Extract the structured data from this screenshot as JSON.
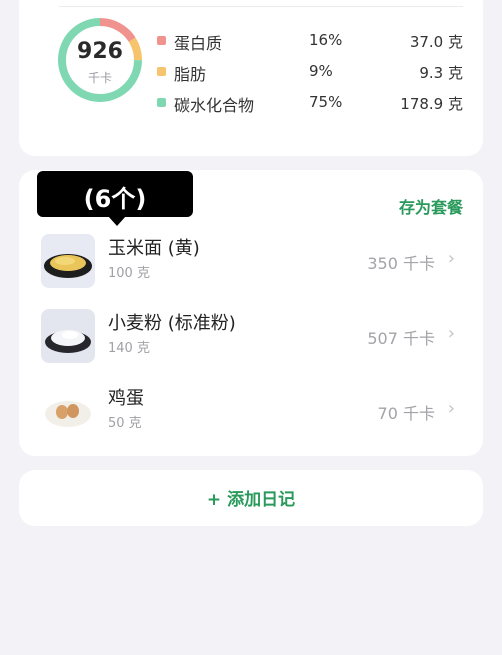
{
  "summary": {
    "calories": "926",
    "calories_unit": "千卡",
    "macros": [
      {
        "name": "蛋白质",
        "percent": "16%",
        "amount": "37.0 克",
        "color": "#f0938f"
      },
      {
        "name": "脂肪",
        "percent": "9%",
        "amount": "9.3 克",
        "color": "#f6c46c"
      },
      {
        "name": "碳水化合物",
        "percent": "75%",
        "amount": "178.9 克",
        "color": "#7fd8b2"
      }
    ]
  },
  "food_list": {
    "tooltip": "(6个)",
    "save_combo_label": "存为套餐",
    "items": [
      {
        "name": "玉米面 (黄)",
        "amount": "100 克",
        "calories": "350 千卡",
        "icon": "cornmeal-icon"
      },
      {
        "name": "小麦粉 (标准粉)",
        "amount": "140 克",
        "calories": "507 千卡",
        "icon": "flour-icon"
      },
      {
        "name": "鸡蛋",
        "amount": "50 克",
        "calories": "70 千卡",
        "icon": "egg-icon"
      }
    ]
  },
  "add_diary_label": "+ 添加日记",
  "colors": {
    "accent": "#2a9a5c"
  }
}
